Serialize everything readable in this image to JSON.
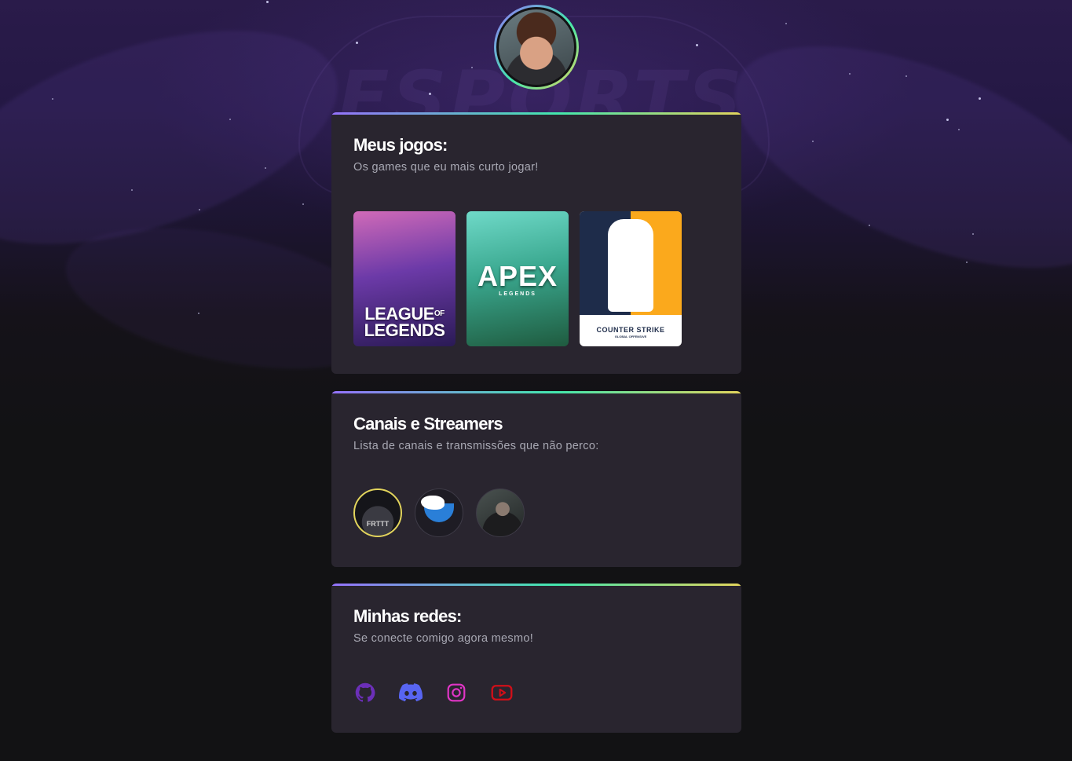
{
  "profile": {
    "avatar_alt": "Foto de perfil"
  },
  "games_card": {
    "title": "Meus jogos:",
    "subtitle": "Os games que eu mais curto jogar!",
    "games": [
      {
        "name": "League of Legends",
        "cover_text_1": "LEAGUE",
        "cover_text_2": "OF",
        "cover_text_3": "LEGENDS"
      },
      {
        "name": "Apex Legends",
        "cover_text_1": "APEX",
        "cover_text_2": "LEGENDS"
      },
      {
        "name": "Counter-Strike",
        "cover_text_1": "COUNTER STRIKE",
        "cover_text_2": "GLOBAL OFFENSIVE"
      }
    ]
  },
  "channels_card": {
    "title": "Canais e Streamers",
    "subtitle": "Lista de canais e transmissões que não perco:",
    "channels": [
      {
        "avatar_text": "FRTTT"
      },
      {
        "avatar_text": ""
      },
      {
        "avatar_text": ""
      }
    ]
  },
  "social_card": {
    "title": "Minhas redes:",
    "subtitle": "Se conecte comigo agora mesmo!",
    "links": [
      {
        "icon": "github-icon",
        "color": "#6b2fb8"
      },
      {
        "icon": "discord-icon",
        "color": "#5865f2"
      },
      {
        "icon": "instagram-icon",
        "color": "#e135c6"
      },
      {
        "icon": "youtube-icon",
        "color": "#d10f19"
      }
    ]
  },
  "colors": {
    "gradient_start": "#9572fc",
    "gradient_mid": "#43e7ad",
    "gradient_end": "#e2d45c",
    "card_bg": "#29252f",
    "page_bg": "#121214"
  }
}
